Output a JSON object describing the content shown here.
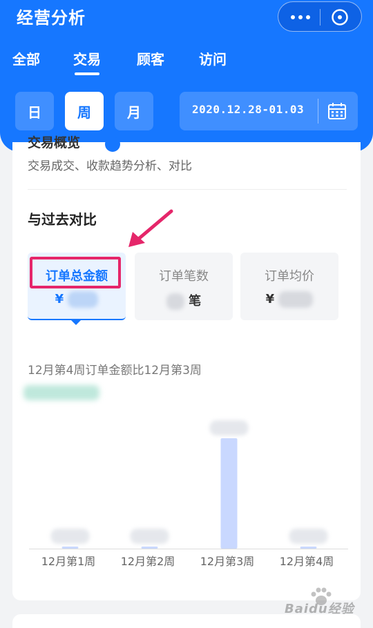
{
  "header": {
    "title": "经营分析",
    "tabs": [
      {
        "label": "全部",
        "active": false
      },
      {
        "label": "交易",
        "active": true
      },
      {
        "label": "顾客",
        "active": false
      },
      {
        "label": "访问",
        "active": false
      }
    ],
    "periods": [
      {
        "label": "日",
        "active": false
      },
      {
        "label": "周",
        "active": true
      },
      {
        "label": "月",
        "active": false
      }
    ],
    "date_range": "2020.12.28-01.03"
  },
  "card": {
    "section_header": "交易概览",
    "subtitle": "交易成交、收款趋势分析、对比",
    "compare_title": "与过去对比",
    "metrics": [
      {
        "label": "订单总金额",
        "prefix": "¥",
        "suffix": "",
        "active": true
      },
      {
        "label": "订单笔数",
        "prefix": "",
        "suffix": "笔",
        "active": false
      },
      {
        "label": "订单均价",
        "prefix": "¥",
        "suffix": "",
        "active": false
      }
    ],
    "chart_title": "12月第4周订单金额比12月第3周"
  },
  "chart_data": {
    "type": "bar",
    "categories": [
      "12月第1周",
      "12月第2周",
      "12月第3周",
      "12月第4周"
    ],
    "values": [
      0,
      0,
      1,
      0
    ]
  },
  "watermark": "Baidu经验",
  "colors": {
    "brand": "#1677ff",
    "highlight": "#e5266a",
    "bar": "#c9d8ff"
  }
}
